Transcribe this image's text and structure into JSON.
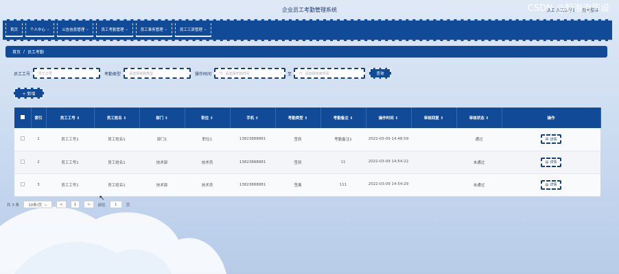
{
  "header": {
    "title": "企业员工考勤管理系统",
    "user": "员工 员工工号1",
    "logout": "退出登录"
  },
  "nav": [
    {
      "label": "首页",
      "dropdown": false
    },
    {
      "label": "个人中心",
      "dropdown": true
    },
    {
      "label": "公告信息管理",
      "dropdown": true
    },
    {
      "label": "员工考勤管理",
      "dropdown": true
    },
    {
      "label": "员工事务管理",
      "dropdown": true
    },
    {
      "label": "员工工资管理",
      "dropdown": true
    }
  ],
  "breadcrumb": {
    "home": "首页",
    "sep": "/",
    "current": "员工考勤"
  },
  "search": {
    "emp_no_label": "员工工号",
    "emp_no_placeholder": "员工工号",
    "type_label": "考勤类型",
    "type_placeholder": "请选择考勤类型",
    "time_label": "操作时间",
    "start_placeholder": "请选择开始时间",
    "to": "至",
    "end_placeholder": "请选择结束时间",
    "query_label": "查询"
  },
  "add_label": "+ 新增",
  "table": {
    "headers": [
      "索引",
      "员工工号 ⇕",
      "员工姓名 ⇕",
      "部门 ⇕",
      "职位 ⇕",
      "手机 ⇕",
      "考勤类型 ⇕",
      "考勤备注 ⇕",
      "操作时间 ⇕",
      "审核回复 ⇕",
      "审核状态 ⇕",
      "操作"
    ],
    "rows": [
      {
        "index": "1",
        "emp_no": "员工工号1",
        "name": "员工姓名1",
        "dept": "部门1",
        "position": "职位1",
        "phone": "13823888881",
        "type": "签到",
        "remark": "考勤备注1",
        "time": "2022-03-09 14:48:59",
        "reply": "",
        "status": "通过",
        "action": "详情"
      },
      {
        "index": "2",
        "emp_no": "员工工号1",
        "name": "员工姓名1",
        "dept": "技术部",
        "position": "技术员",
        "phone": "13823888881",
        "type": "签到",
        "remark": "11",
        "time": "2022-03-09 14:54:22",
        "reply": "",
        "status": "未通过",
        "action": "详情"
      },
      {
        "index": "3",
        "emp_no": "员工工号1",
        "name": "员工姓名1",
        "dept": "技术部",
        "position": "技术员",
        "phone": "13823888881",
        "type": "签离",
        "remark": "111",
        "time": "2022-03-09 14:54:29",
        "reply": "",
        "status": "未通过",
        "action": "详情"
      }
    ]
  },
  "pager": {
    "total": "共 3 条",
    "per_page": "10条/页",
    "prev": "<",
    "page": "1",
    "next": ">",
    "goto_label": "前往",
    "goto_value": "1",
    "page_unit": "页"
  },
  "watermark": "CSDN @粉泡泡毕设",
  "colors": {
    "primary": "#114a96",
    "background": "#cfdcf1"
  }
}
